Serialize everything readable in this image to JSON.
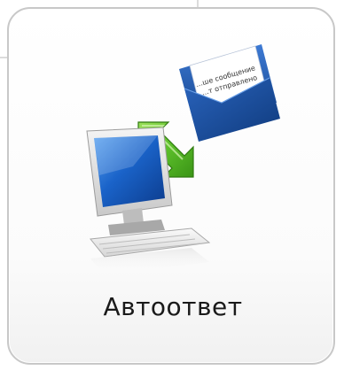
{
  "tile": {
    "label": "Автоответ",
    "icon": "autoreply-icon"
  },
  "envelope": {
    "letter_lines": [
      "...ше сообщение",
      "...т отправлено"
    ]
  },
  "colors": {
    "border": "#c8c8c8",
    "envelope_blue": "#1f54a6",
    "arrow_green": "#5cbf2a",
    "screen_blue": "#1a63c9",
    "label_text": "#1a1a1a"
  }
}
